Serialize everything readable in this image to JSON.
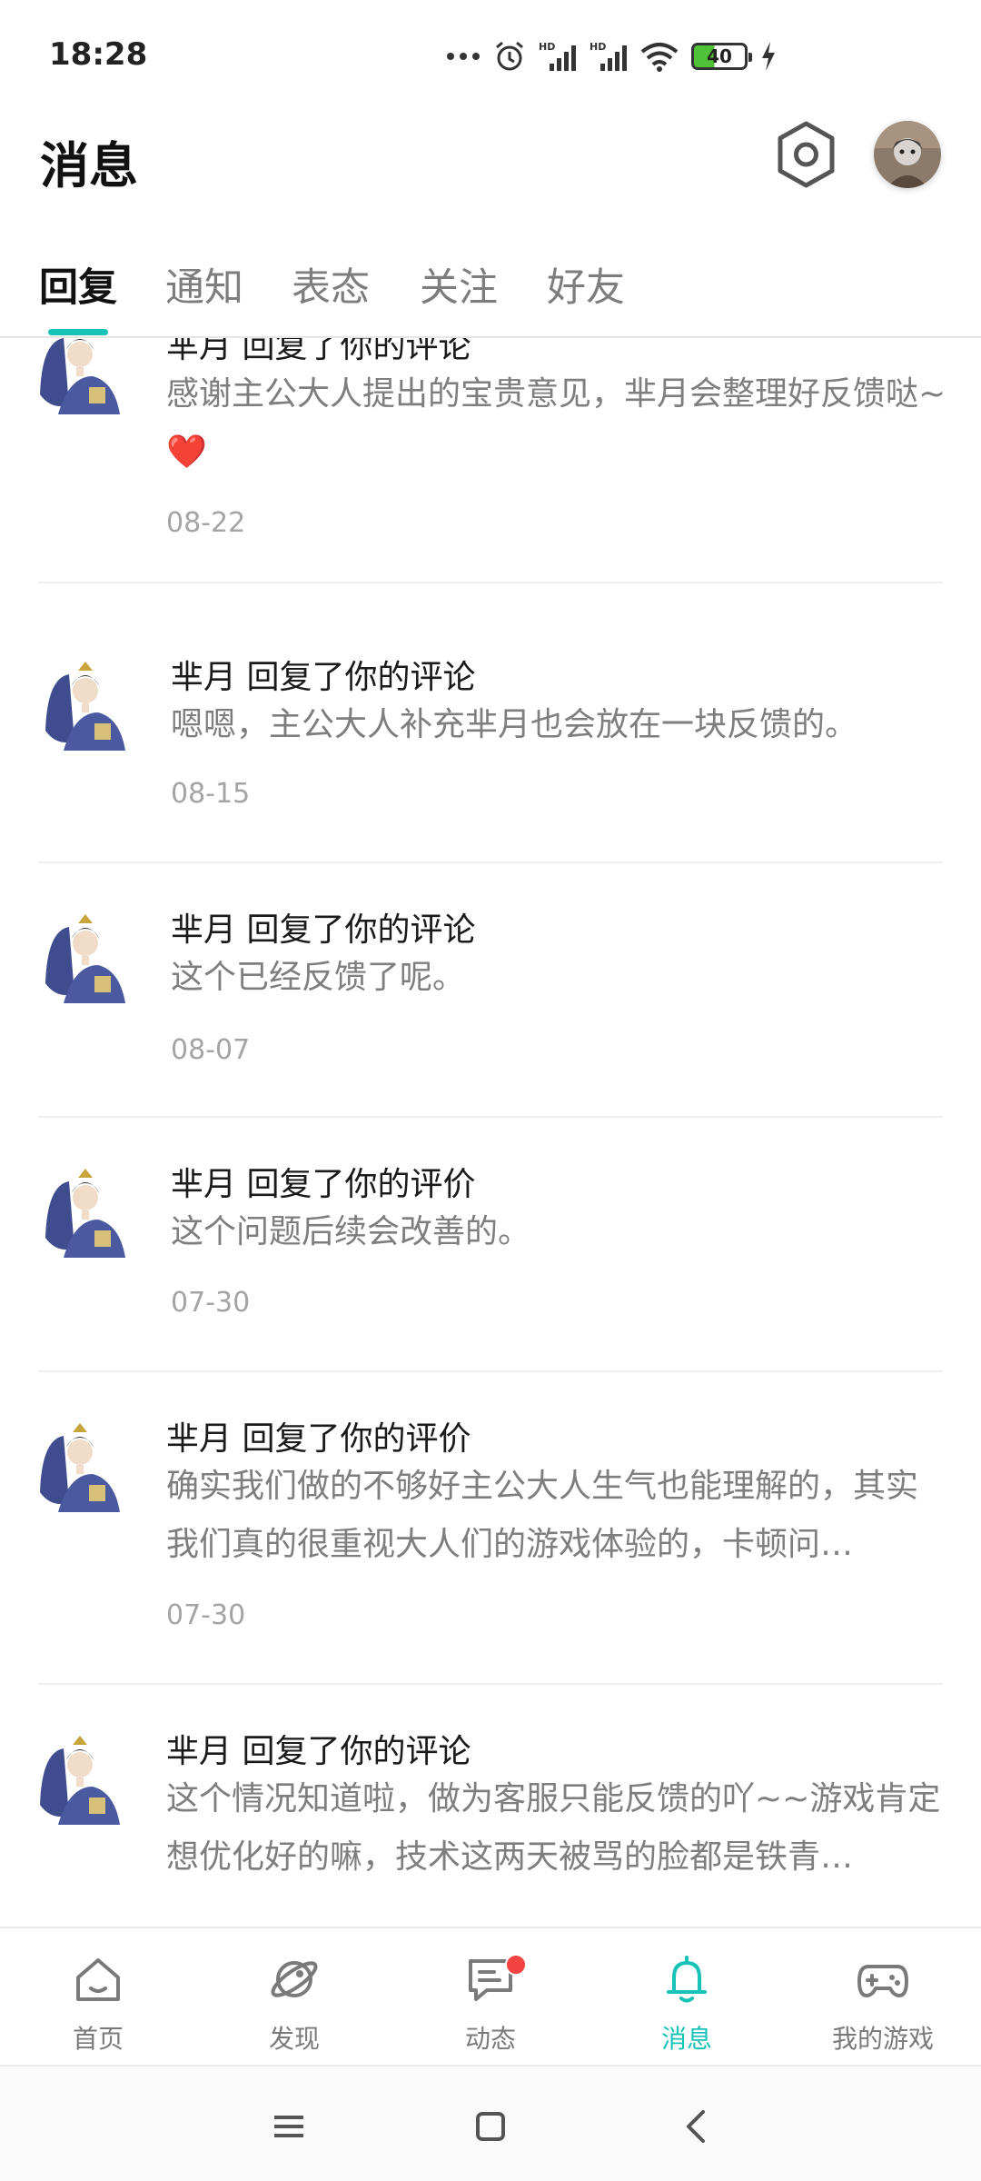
{
  "status_bar": {
    "time": "18:28",
    "battery_level": "40",
    "icons": [
      "more-dots-icon",
      "alarm-icon",
      "signal-hd-icon",
      "signal-hd-icon",
      "wifi-icon",
      "battery-icon",
      "charging-icon"
    ]
  },
  "header": {
    "title": "消息",
    "settings_icon": "settings-hexagon-icon",
    "avatar_icon": "user-avatar"
  },
  "tabs": [
    {
      "label": "回复",
      "active": true
    },
    {
      "label": "通知",
      "active": false
    },
    {
      "label": "表态",
      "active": false
    },
    {
      "label": "关注",
      "active": false
    },
    {
      "label": "好友",
      "active": false
    }
  ],
  "messages": [
    {
      "sender": "芈月",
      "title": "芈月 回复了你的评论",
      "text": "感谢主公大人提出的宝贵意见，芈月会整理好反馈哒~❤️",
      "date": "08-22"
    },
    {
      "sender": "芈月",
      "title": "芈月 回复了你的评论",
      "text": "嗯嗯，主公大人补充芈月也会放在一块反馈的。",
      "date": "08-15"
    },
    {
      "sender": "芈月",
      "title": "芈月 回复了你的评论",
      "text": "这个已经反馈了呢。",
      "date": "08-07"
    },
    {
      "sender": "芈月",
      "title": "芈月 回复了你的评价",
      "text": "这个问题后续会改善的。",
      "date": "07-30"
    },
    {
      "sender": "芈月",
      "title": "芈月 回复了你的评价",
      "text": "确实我们做的不够好主公大人生气也能理解的，其实我们真的很重视大人们的游戏体验的，卡顿问…",
      "date": "07-30"
    },
    {
      "sender": "芈月",
      "title": "芈月 回复了你的评论",
      "text": "这个情况知道啦，做为客服只能反馈的吖~~游戏肯定想优化好的嘛，技术这两天被骂的脸都是铁青…",
      "date": ""
    }
  ],
  "bottom_nav": [
    {
      "label": "首页",
      "icon": "home-icon",
      "active": false,
      "badge": false
    },
    {
      "label": "发现",
      "icon": "discover-planet-icon",
      "active": false,
      "badge": false
    },
    {
      "label": "动态",
      "icon": "chat-bubble-icon",
      "active": false,
      "badge": true
    },
    {
      "label": "消息",
      "icon": "bell-icon",
      "active": true,
      "badge": false
    },
    {
      "label": "我的游戏",
      "icon": "gamepad-icon",
      "active": false,
      "badge": false
    }
  ],
  "system_nav": [
    "menu-icon",
    "home-square-icon",
    "back-icon"
  ],
  "colors": {
    "accent": "#17c3b6",
    "text_primary": "#1a1a1a",
    "text_secondary": "#7e7e7e",
    "text_date": "#a4a4a4",
    "badge": "#f34343"
  }
}
